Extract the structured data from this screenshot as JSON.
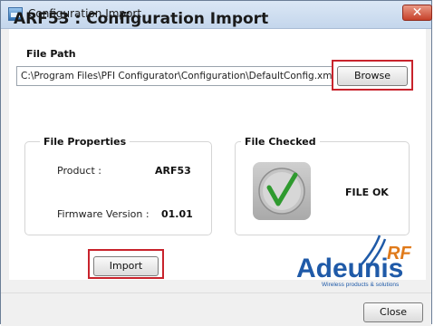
{
  "window": {
    "title": "Configuration Import",
    "close_glyph": "✕"
  },
  "heading": "ARF53 : Configuration Import",
  "file_path": {
    "label": "File Path",
    "value": "C:\\Program Files\\PFI Configurator\\Configuration\\DefaultConfig.xml",
    "browse_label": "Browse"
  },
  "file_properties": {
    "legend": "File Properties",
    "product_label": "Product :",
    "product_value": "ARF53",
    "firmware_label": "Firmware Version :",
    "firmware_value": "01.01"
  },
  "file_checked": {
    "legend": "File Checked",
    "status": "FILE OK"
  },
  "import_label": "Import",
  "close_label": "Close",
  "logo": {
    "word": "Adeunis",
    "mark": "RF",
    "tagline": "Wireless products & solutions"
  },
  "colors": {
    "highlight": "#c8232c",
    "logo_blue": "#1f5aa8",
    "logo_orange": "#e07a1a",
    "check_green": "#2f9a2f"
  },
  "icons": [
    "app-icon",
    "close-icon",
    "checkmark-icon",
    "logo-waves-icon"
  ]
}
